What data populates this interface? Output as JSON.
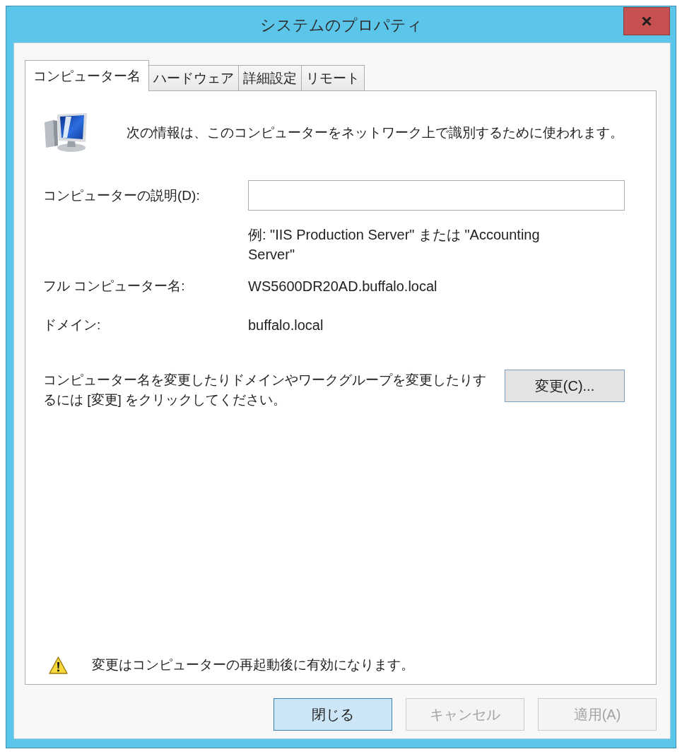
{
  "window": {
    "title": "システムのプロパティ"
  },
  "tabs": [
    {
      "label": "コンピューター名",
      "selected": true
    },
    {
      "label": "ハードウェア",
      "selected": false
    },
    {
      "label": "詳細設定",
      "selected": false
    },
    {
      "label": "リモート",
      "selected": false
    }
  ],
  "computer_name_tab": {
    "intro": "次の情報は、このコンピューターをネットワーク上で識別するために使われます。",
    "fields": [
      {
        "kind": "input",
        "label": "コンピューターの説明(D):",
        "hint": "例: \"IIS Production Server\" または \"Accounting Server\""
      },
      {
        "kind": "text",
        "label": "フル コンピューター名:",
        "value": "WS5600DR20AD.buffalo.local"
      },
      {
        "kind": "text",
        "label": "ドメイン:",
        "value": "buffalo.local"
      }
    ],
    "change_note": "コンピューター名を変更したりドメインやワークグループを変更したりするには [変更] をクリックしてください。",
    "change_button": "変更(C)...",
    "warning": "変更はコンピューターの再起動後に有効になります。"
  },
  "buttons": [
    {
      "label": "閉じる",
      "default": true,
      "disabled": false
    },
    {
      "label": "キャンセル",
      "default": false,
      "disabled": true
    },
    {
      "label": "適用(A)",
      "default": false,
      "disabled": true
    }
  ]
}
